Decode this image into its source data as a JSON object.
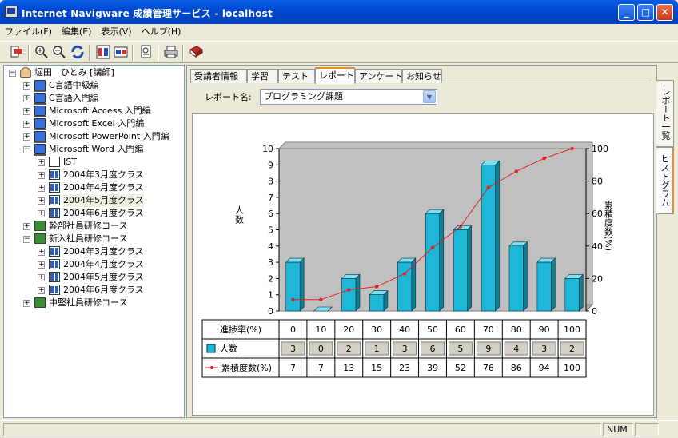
{
  "window": {
    "title": "Internet Navigware 成績管理サービス - localhost"
  },
  "menu": [
    "ファイル(F)",
    "編集(E)",
    "表示(V)",
    "ヘルプ(H)"
  ],
  "toolbar_icons": [
    "exit-icon",
    "zoom-in-icon",
    "zoom-out-icon",
    "refresh-icon",
    "tile-icon",
    "compare-icon",
    "report-icon",
    "print-icon",
    "book-icon"
  ],
  "tree": [
    {
      "label": "堀田　ひとみ [講師]",
      "level": 0,
      "expander": "minus",
      "icon": "user"
    },
    {
      "label": "C言語中級編",
      "level": 1,
      "expander": "plus",
      "icon": "pc"
    },
    {
      "label": "C言語入門編",
      "level": 1,
      "expander": "plus",
      "icon": "pc"
    },
    {
      "label": "Microsoft Access 入門編",
      "level": 1,
      "expander": "plus",
      "icon": "pc"
    },
    {
      "label": "Microsoft Excel 入門編",
      "level": 1,
      "expander": "plus",
      "icon": "pc"
    },
    {
      "label": "Microsoft PowerPoint 入門編",
      "level": 1,
      "expander": "plus",
      "icon": "pc"
    },
    {
      "label": "Microsoft Word 入門編",
      "level": 1,
      "expander": "minus",
      "icon": "pc"
    },
    {
      "label": "IST",
      "level": 2,
      "expander": "plus",
      "icon": "ist"
    },
    {
      "label": "2004年3月度クラス",
      "level": 2,
      "expander": "plus",
      "icon": "cls"
    },
    {
      "label": "2004年4月度クラス",
      "level": 2,
      "expander": "plus",
      "icon": "cls"
    },
    {
      "label": "2004年5月度クラス",
      "level": 2,
      "expander": "plus",
      "icon": "cls",
      "selected": true
    },
    {
      "label": "2004年6月度クラス",
      "level": 2,
      "expander": "plus",
      "icon": "cls"
    },
    {
      "label": "幹部社員研修コース",
      "level": 1,
      "expander": "plus",
      "icon": "grp"
    },
    {
      "label": "新入社員研修コース",
      "level": 1,
      "expander": "minus",
      "icon": "grp"
    },
    {
      "label": "2004年3月度クラス",
      "level": 2,
      "expander": "plus",
      "icon": "cls"
    },
    {
      "label": "2004年4月度クラス",
      "level": 2,
      "expander": "plus",
      "icon": "cls"
    },
    {
      "label": "2004年5月度クラス",
      "level": 2,
      "expander": "plus",
      "icon": "cls"
    },
    {
      "label": "2004年6月度クラス",
      "level": 2,
      "expander": "plus",
      "icon": "cls"
    },
    {
      "label": "中堅社員研修コース",
      "level": 1,
      "expander": "plus",
      "icon": "grp"
    }
  ],
  "tabs": [
    "受講者情報",
    "学習",
    "テスト",
    "レポート",
    "アンケート",
    "お知らせ"
  ],
  "active_tab": 3,
  "report": {
    "label": "レポート名:",
    "selected": "プログラミング課題"
  },
  "side_tabs": [
    "レポート一覧",
    "ヒストグラム"
  ],
  "active_side_tab": 1,
  "status": {
    "num": "NUM"
  },
  "colors": {
    "bar": "#1eb7d8",
    "line": "#e02020",
    "plot_bg": "#c0c0c0"
  },
  "chart_data": {
    "type": "bar",
    "categories": [
      "0",
      "10",
      "20",
      "30",
      "40",
      "50",
      "60",
      "70",
      "80",
      "90",
      "100"
    ],
    "series": [
      {
        "name": "人数",
        "type": "bar",
        "values": [
          3,
          0,
          2,
          1,
          3,
          6,
          5,
          9,
          4,
          3,
          2
        ]
      },
      {
        "name": "累積度数(%)",
        "type": "line",
        "values": [
          7,
          7,
          13,
          15,
          23,
          39,
          52,
          76,
          86,
          94,
          100
        ]
      }
    ],
    "xlabel": "進捗率(%)",
    "ylabel": "人数",
    "y2label": "累積度数(%)",
    "ylim": [
      0,
      10
    ],
    "y2lim": [
      0,
      100
    ],
    "yticks": [
      "0",
      "1",
      "2",
      "3",
      "4",
      "5",
      "6",
      "7",
      "8",
      "9",
      "10"
    ],
    "y2ticks": [
      "0",
      "20",
      "40",
      "60",
      "80",
      "100"
    ],
    "grid": false,
    "legend": "table-bottom"
  }
}
